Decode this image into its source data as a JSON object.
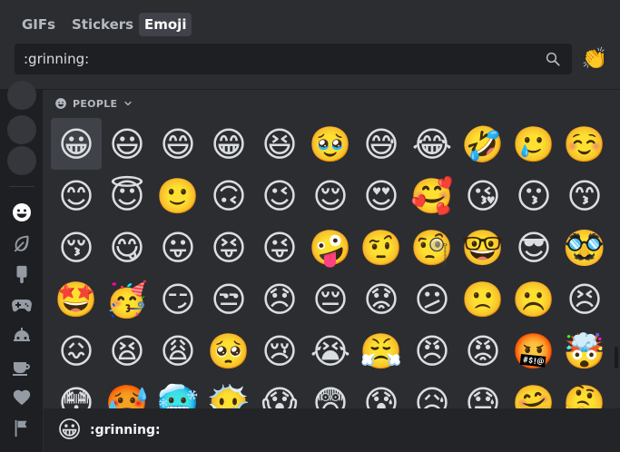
{
  "tabs": [
    {
      "label": "GIFs",
      "active": false
    },
    {
      "label": "Stickers",
      "active": false
    },
    {
      "label": "Emoji",
      "active": true
    }
  ],
  "search": {
    "value": ":grinning:",
    "placeholder": ""
  },
  "clap_button": {
    "icon": "👏"
  },
  "sidebar": {
    "categories": [
      {
        "name": "people-icon",
        "active": true
      },
      {
        "name": "nature-icon",
        "active": false
      },
      {
        "name": "food-icon",
        "active": false
      },
      {
        "name": "activity-icon",
        "active": false
      },
      {
        "name": "travel-icon",
        "active": false
      },
      {
        "name": "objects-icon",
        "active": false
      },
      {
        "name": "symbols-icon",
        "active": false
      },
      {
        "name": "flags-icon",
        "active": false
      }
    ]
  },
  "section": {
    "title": "PEOPLE"
  },
  "emojis": [
    "😀",
    "😃",
    "😄",
    "😁",
    "😆",
    "🥹",
    "😅",
    "😂",
    "🤣",
    "🥲",
    "☺️",
    "😊",
    "😇",
    "🙂",
    "🙃",
    "😉",
    "😌",
    "😍",
    "🥰",
    "😘",
    "😗",
    "😙",
    "😚",
    "😋",
    "😛",
    "😝",
    "😜",
    "🤪",
    "🤨",
    "🧐",
    "🤓",
    "😎",
    "🥸",
    "🤩",
    "🥳",
    "😏",
    "😒",
    "😞",
    "😔",
    "😟",
    "😕",
    "🙁",
    "☹️",
    "😣",
    "😖",
    "😫",
    "😩",
    "🥺",
    "😢",
    "😭",
    "😤",
    "😠",
    "😡",
    "🤬",
    "🤯",
    "😳",
    "🥵",
    "🥶",
    "😶‍🌫️",
    "😱",
    "😨",
    "😰",
    "😥",
    "😓",
    "🤗",
    "🤔"
  ],
  "preview": {
    "emoji": "😀",
    "name": ":grinning:"
  }
}
